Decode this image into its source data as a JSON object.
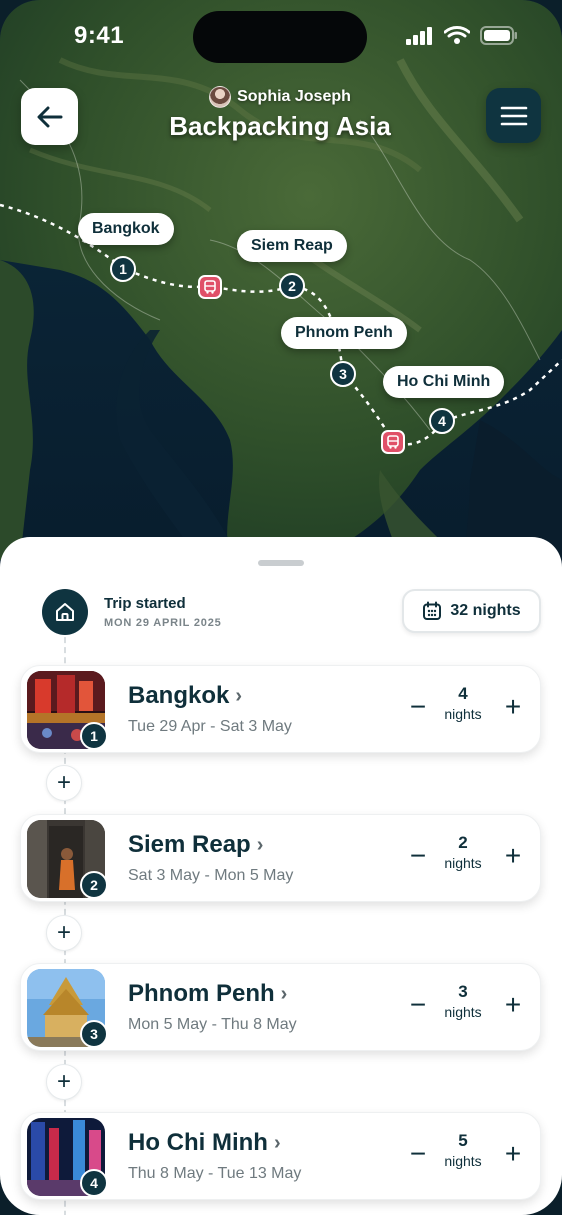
{
  "status_bar": {
    "time": "9:41"
  },
  "header": {
    "owner_name": "Sophia Joseph",
    "trip_title": "Backpacking Asia"
  },
  "map": {
    "pins": [
      {
        "number": "1",
        "label": "Bangkok"
      },
      {
        "number": "2",
        "label": "Siem Reap"
      },
      {
        "number": "3",
        "label": "Phnom Penh"
      },
      {
        "number": "4",
        "label": "Ho Chi Minh"
      }
    ],
    "transport_markers": [
      "bus-icon",
      "bus-icon"
    ]
  },
  "trip_start": {
    "title": "Trip started",
    "date": "MON 29 APRIL 2025",
    "total_nights": "32 nights"
  },
  "stops": [
    {
      "number": "1",
      "city": "Bangkok",
      "dates": "Tue 29 Apr - Sat 3 May",
      "nights": "4",
      "unit": "nights"
    },
    {
      "number": "2",
      "city": "Siem Reap",
      "dates": "Sat 3 May - Mon 5 May",
      "nights": "2",
      "unit": "nights"
    },
    {
      "number": "3",
      "city": "Phnom Penh",
      "dates": "Mon 5 May - Thu 8 May",
      "nights": "3",
      "unit": "nights"
    },
    {
      "number": "4",
      "city": "Ho Chi Minh",
      "dates": "Thu 8 May - Tue 13 May",
      "nights": "5",
      "unit": "nights"
    }
  ],
  "controls": {
    "minus": "−",
    "plus": "+",
    "add_stop": "+",
    "chevron": "›"
  },
  "colors": {
    "primary": "#0f3440",
    "transport": "#e05068"
  }
}
